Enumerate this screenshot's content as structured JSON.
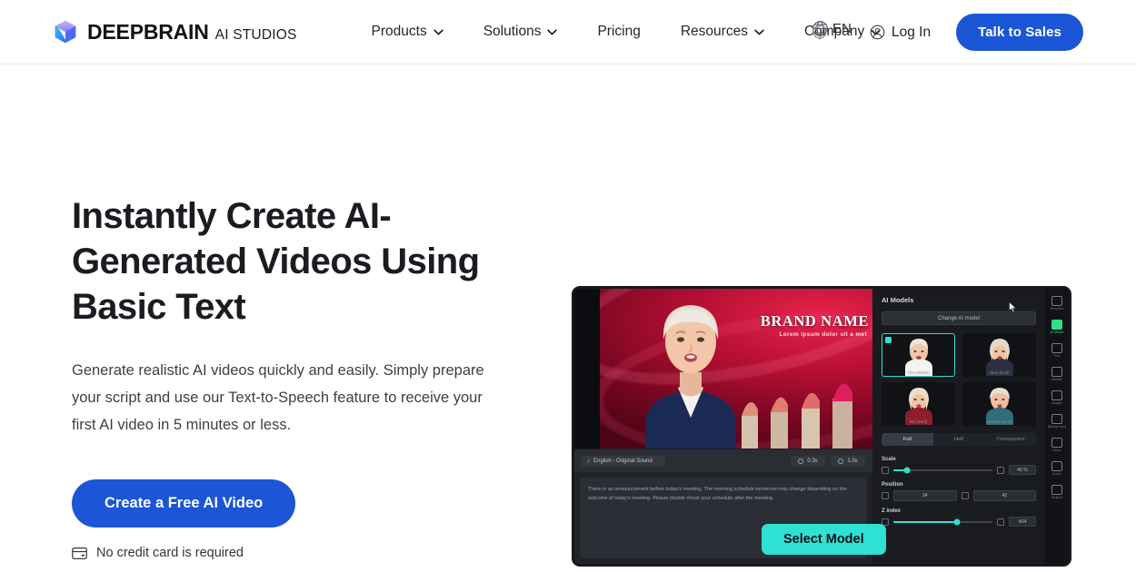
{
  "header": {
    "brand": {
      "name": "DEEPBRAIN",
      "sub": "AI STUDIOS",
      "logo_icon": "cube-logo-icon"
    },
    "nav": [
      {
        "label": "Products",
        "has_dropdown": true
      },
      {
        "label": "Solutions",
        "has_dropdown": true
      },
      {
        "label": "Pricing",
        "has_dropdown": false
      },
      {
        "label": "Resources",
        "has_dropdown": true
      },
      {
        "label": "Company",
        "has_dropdown": true
      }
    ],
    "language": {
      "label": "EN",
      "icon": "globe-icon"
    },
    "login": {
      "label": "Log In",
      "icon": "user-circle-icon"
    },
    "cta": {
      "label": "Talk to Sales"
    }
  },
  "hero": {
    "title": "Instantly Create AI-Generated Videos Using Basic Text",
    "subtitle": "Generate realistic AI videos quickly and easily. Simply prepare your script and use our Text-to-Speech feature to receive your first AI video in 5 minutes or less.",
    "cta": "Create a Free AI Video",
    "note": "No credit card is required",
    "note_icon": "credit-card-icon"
  },
  "app_preview": {
    "slide": {
      "brand_title": "BRAND NAME",
      "brand_subtitle": "Lorem ipsum dolor sit a met"
    },
    "toolbar": {
      "language_chip": "English - Original Sound",
      "time_chips": [
        "0.3s",
        "1.0s"
      ]
    },
    "script": "There is an announcement before today's meeting. The morning schedule tomorrow may change depending on the outcome of today's meeting. Please double check your schedule after the meeting.",
    "panel": {
      "title": "AI Models",
      "change_button": "Change AI model",
      "models": [
        {
          "name": "Tina (White)",
          "selected": true
        },
        {
          "name": "Jenn (Suit)",
          "selected": false
        },
        {
          "name": "Rio (Red)",
          "selected": false
        },
        {
          "name": "Eleanor (Knit)",
          "selected": false
        }
      ],
      "tabs": [
        {
          "label": "Full",
          "active": true
        },
        {
          "label": "Half",
          "active": false
        },
        {
          "label": "Transparent",
          "active": false
        }
      ],
      "controls": [
        {
          "label": "Scale",
          "value": "46 %",
          "fill_percent": 14
        },
        {
          "label": "Position",
          "value_x": "34",
          "value_y": "42"
        },
        {
          "label": "Z index",
          "value": "404",
          "fill_percent": 64
        }
      ]
    },
    "rail": [
      {
        "label": "Template",
        "active": false
      },
      {
        "label": "AI Model",
        "active": true
      },
      {
        "label": "Text",
        "active": false
      },
      {
        "label": "Subtitle",
        "active": false
      },
      {
        "label": "Images",
        "active": false
      },
      {
        "label": "Background",
        "active": false
      },
      {
        "label": "Video",
        "active": false
      },
      {
        "label": "Audio",
        "active": false
      },
      {
        "label": "Shapes",
        "active": false
      }
    ],
    "select_model_button": "Select Model"
  },
  "colors": {
    "brand_blue": "#1a56d6",
    "accent_teal": "#2fe0d5",
    "rail_green": "#2ee08a",
    "page_bg": "#ffffff",
    "text_dark": "#1b1c21"
  }
}
